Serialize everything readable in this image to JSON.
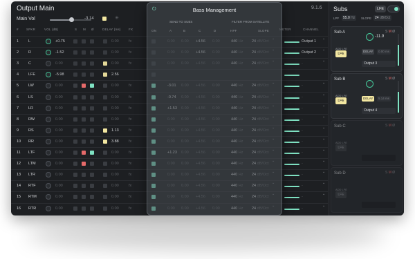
{
  "header": {
    "title": "Output Main",
    "main_vol_label": "Main Vol",
    "main_vol_value": "-3.14",
    "version": "9.1.6"
  },
  "columns": {
    "num": "#",
    "spkr": "SPKR",
    "vol": "VOL (dB)",
    "s": "S",
    "m": "M",
    "phase": "Ø",
    "delay": "DELAY (ms)",
    "fx": "FX",
    "on": "ON",
    "a": "A",
    "b": "B",
    "c": "C",
    "d": "D",
    "hpf": "HPF",
    "slope": "SLOPE",
    "meter": "METER",
    "channel": "CHANNEL"
  },
  "bass_management": {
    "title": "Bass Management",
    "send_to_subs": "SEND TO SUBS",
    "filter_from_satellite": "FILTER FROM SATELLITE"
  },
  "channels": [
    {
      "num": "1",
      "name": "L",
      "vol": "+0.75",
      "delay": "0.00",
      "fx": "fx",
      "a": "0.00",
      "b": "0.00",
      "c": "+4.56",
      "d": "0.00",
      "hpf": "440",
      "hpf_unit": "Hz",
      "slope": "24",
      "slope_unit": "dB/Oct",
      "channel": "Output 1",
      "on": false,
      "s": false,
      "m": false,
      "phi": false,
      "delay_on": false,
      "meter": true
    },
    {
      "num": "2",
      "name": "R",
      "vol": "-1.52",
      "delay": "0.00",
      "fx": "fx",
      "a": "0.00",
      "b": "0.00",
      "c": "+4.56",
      "d": "0.00",
      "hpf": "440",
      "hpf_unit": "Hz",
      "slope": "24",
      "slope_unit": "dB/Oct",
      "channel": "Output 2",
      "on": false,
      "s": false,
      "m": false,
      "phi": false,
      "delay_on": false,
      "meter": true
    },
    {
      "num": "3",
      "name": "C",
      "vol": "0.00",
      "delay": "0.00",
      "fx": "fx",
      "a": "0.00",
      "b": "0.00",
      "c": "+4.56",
      "d": "0.00",
      "hpf": "440",
      "hpf_unit": "Hz",
      "slope": "24",
      "slope_unit": "dB/Oct",
      "channel": "-",
      "on": false,
      "s": false,
      "m": false,
      "phi": false,
      "delay_on": true,
      "meter": true
    },
    {
      "num": "4",
      "name": "LFE",
      "vol": "-5.98",
      "delay": "2.56",
      "fx": "",
      "a": "",
      "b": "",
      "c": "",
      "d": "",
      "hpf": "",
      "hpf_unit": "",
      "slope": "",
      "slope_unit": "",
      "channel": "",
      "on": false,
      "s": false,
      "m": false,
      "phi": false,
      "delay_on": true,
      "meter": true
    },
    {
      "num": "5",
      "name": "LW",
      "vol": "0.00",
      "delay": "0.00",
      "fx": "fx",
      "a": "-3.01",
      "b": "0.00",
      "c": "+4.56",
      "d": "0.00",
      "hpf": "440",
      "hpf_unit": "Hz",
      "slope": "24",
      "slope_unit": "dB/Oct",
      "channel": "-",
      "on": true,
      "s": false,
      "m": true,
      "phi": true,
      "delay_on": false,
      "meter": true
    },
    {
      "num": "6",
      "name": "LS",
      "vol": "0.00",
      "delay": "0.00",
      "fx": "fx",
      "a": "-0.74",
      "b": "0.00",
      "c": "+4.56",
      "d": "0.00",
      "hpf": "440",
      "hpf_unit": "Hz",
      "slope": "24",
      "slope_unit": "dB/Oct",
      "channel": "-",
      "on": true,
      "s": false,
      "m": false,
      "phi": false,
      "delay_on": false,
      "meter": true
    },
    {
      "num": "7",
      "name": "LR",
      "vol": "0.00",
      "delay": "0.00",
      "fx": "fx",
      "a": "+1.53",
      "b": "0.00",
      "c": "+4.56",
      "d": "0.00",
      "hpf": "440",
      "hpf_unit": "Hz",
      "slope": "24",
      "slope_unit": "dB/Oct",
      "channel": "-",
      "on": true,
      "s": false,
      "m": false,
      "phi": false,
      "delay_on": false,
      "meter": true
    },
    {
      "num": "8",
      "name": "RW",
      "vol": "0.00",
      "delay": "0.00",
      "fx": "fx",
      "a": "0.00",
      "b": "0.00",
      "c": "+4.56",
      "d": "0.00",
      "hpf": "440",
      "hpf_unit": "Hz",
      "slope": "24",
      "slope_unit": "dB/Oct",
      "channel": "-",
      "on": true,
      "s": false,
      "m": false,
      "phi": false,
      "delay_on": false,
      "meter": true
    },
    {
      "num": "9",
      "name": "RS",
      "vol": "0.00",
      "delay": "1.13",
      "fx": "fx",
      "a": "0.00",
      "b": "0.00",
      "c": "+4.56",
      "d": "0.00",
      "hpf": "440",
      "hpf_unit": "Hz",
      "slope": "24",
      "slope_unit": "dB/Oct",
      "channel": "-",
      "on": true,
      "s": false,
      "m": false,
      "phi": false,
      "delay_on": true,
      "meter": true
    },
    {
      "num": "10",
      "name": "RR",
      "vol": "0.00",
      "delay": "3.88",
      "fx": "fx",
      "a": "0.00",
      "b": "0.00",
      "c": "+4.56",
      "d": "0.00",
      "hpf": "440",
      "hpf_unit": "Hz",
      "slope": "24",
      "slope_unit": "dB/Oct",
      "channel": "-",
      "on": true,
      "s": false,
      "m": false,
      "phi": false,
      "delay_on": true,
      "meter": true
    },
    {
      "num": "11",
      "name": "LTF",
      "vol": "0.00",
      "delay": "0.00",
      "fx": "fx",
      "a": "+1.23",
      "b": "0.00",
      "c": "+4.56",
      "d": "0.00",
      "hpf": "440",
      "hpf_unit": "Hz",
      "slope": "24",
      "slope_unit": "dB/Oct",
      "channel": "-",
      "on": true,
      "s": false,
      "m": true,
      "phi": true,
      "delay_on": false,
      "meter": true
    },
    {
      "num": "12",
      "name": "LTM",
      "vol": "0.00",
      "delay": "0.00",
      "fx": "fx",
      "a": "0.00",
      "b": "0.00",
      "c": "+4.56",
      "d": "0.00",
      "hpf": "440",
      "hpf_unit": "Hz",
      "slope": "24",
      "slope_unit": "dB/Oct",
      "channel": "-",
      "on": true,
      "s": false,
      "m": true,
      "phi": false,
      "delay_on": false,
      "meter": true
    },
    {
      "num": "13",
      "name": "LTR",
      "vol": "0.00",
      "delay": "0.00",
      "fx": "fx",
      "a": "0.00",
      "b": "0.00",
      "c": "+4.56",
      "d": "0.00",
      "hpf": "440",
      "hpf_unit": "Hz",
      "slope": "24",
      "slope_unit": "dB/Oct",
      "channel": "-",
      "on": true,
      "s": false,
      "m": false,
      "phi": false,
      "delay_on": false,
      "meter": true
    },
    {
      "num": "14",
      "name": "RTF",
      "vol": "0.00",
      "delay": "0.00",
      "fx": "fx",
      "a": "0.00",
      "b": "0.00",
      "c": "+4.56",
      "d": "0.00",
      "hpf": "440",
      "hpf_unit": "Hz",
      "slope": "24",
      "slope_unit": "dB/Oct",
      "channel": "-",
      "on": true,
      "s": false,
      "m": false,
      "phi": false,
      "delay_on": false,
      "meter": true
    },
    {
      "num": "15",
      "name": "RTM",
      "vol": "0.00",
      "delay": "0.00",
      "fx": "fx",
      "a": "0.00",
      "b": "0.00",
      "c": "+4.56",
      "d": "0.00",
      "hpf": "440",
      "hpf_unit": "Hz",
      "slope": "24",
      "slope_unit": "dB/Oct",
      "channel": "-",
      "on": true,
      "s": false,
      "m": false,
      "phi": false,
      "delay_on": false,
      "meter": true
    },
    {
      "num": "16",
      "name": "RTR",
      "vol": "0.00",
      "delay": "0.00",
      "fx": "fx",
      "a": "0.00",
      "b": "0.00",
      "c": "+4.56",
      "d": "0.00",
      "hpf": "440",
      "hpf_unit": "Hz",
      "slope": "24",
      "slope_unit": "dB/Oct",
      "channel": "-",
      "on": true,
      "s": false,
      "m": false,
      "phi": false,
      "delay_on": false,
      "meter": true
    }
  ],
  "subs": {
    "title": "Subs",
    "lfe_label": "LFE",
    "lpf_label": "LPF",
    "lpf_value": "55.0",
    "lpf_unit": "Hz",
    "slope_label": "SLOPE",
    "slope_value": "24",
    "slope_unit": "dB/Oct",
    "cards": [
      {
        "name": "Sub A",
        "flags_s": "S",
        "flags_m": "M",
        "flags_phi": "Ø",
        "vol": "-11.9",
        "add_lfe_label": "ADD LFE",
        "lfe_label": "LFE",
        "delay_label": "DELAY",
        "delay_value": "0.00 ms",
        "output": "Output 3",
        "active": true,
        "delay_on": false
      },
      {
        "name": "Sub B",
        "flags_s": "S",
        "flags_m": "M",
        "flags_phi": "Ø",
        "vol": "",
        "add_lfe_label": "ADD LFE",
        "lfe_label": "LFE",
        "delay_label": "DELAY",
        "delay_value": "5.14 ms",
        "output": "Output 4",
        "active": true,
        "delay_on": true
      },
      {
        "name": "Sub C",
        "flags_s": "S",
        "flags_m": "M",
        "flags_phi": "Ø",
        "vol": "",
        "add_lfe_label": "ADD LFE",
        "lfe_label": "LFE",
        "delay_label": "",
        "delay_value": "",
        "output": "",
        "active": false,
        "delay_on": false
      },
      {
        "name": "Sub D",
        "flags_s": "S",
        "flags_m": "M",
        "flags_phi": "Ø",
        "vol": "",
        "add_lfe_label": "ADD LFE",
        "lfe_label": "LFE",
        "delay_label": "",
        "delay_value": "",
        "output": "",
        "active": false,
        "delay_on": false
      }
    ]
  },
  "icons": {
    "power": "power-icon",
    "asterisk": "asterisk-icon",
    "chevron": "chevron-down-icon"
  },
  "colors": {
    "accent_mint": "#7fe2c3",
    "accent_yellow": "#f3e7a1",
    "mute_red": "#e66a6a",
    "panel_bg": "#1d1f22"
  }
}
